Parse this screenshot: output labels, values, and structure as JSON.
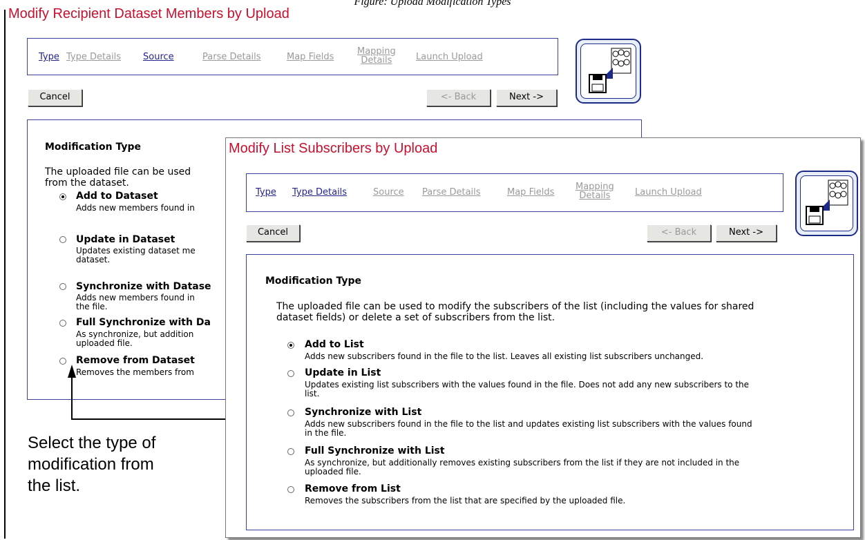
{
  "caption": "Figure: Upload Modification Types",
  "back_window": {
    "title": "Modify Recipient Dataset Members by Upload",
    "steps": [
      {
        "label": "Type",
        "state": "active"
      },
      {
        "label": "Type Details",
        "state": "inactive"
      },
      {
        "label": "Source",
        "state": "active"
      },
      {
        "label": "Parse Details",
        "state": "inactive"
      },
      {
        "label": "Map Fields",
        "state": "inactive"
      },
      {
        "label_line1": "Mapping",
        "label_line2": "Details",
        "state": "inactive"
      },
      {
        "label": "Launch Upload",
        "state": "inactive"
      }
    ],
    "cancel": "Cancel",
    "back": "<- Back",
    "next": "Next ->",
    "section_heading": "Modification Type",
    "intro_line1": "The uploaded file can be used",
    "intro_line2": "from the dataset.",
    "options": [
      {
        "label": "Add to Dataset",
        "desc1": "Adds new members found in",
        "desc2": "",
        "selected": true
      },
      {
        "label": "Update in Dataset",
        "desc1": "Updates existing dataset me",
        "desc2": "dataset.",
        "selected": false
      },
      {
        "label": "Synchronize with Datase",
        "desc1": "Adds new members found in",
        "desc2": "the file.",
        "selected": false
      },
      {
        "label": "Full Synchronize with Da",
        "desc1": "As synchronize, but addition",
        "desc2": "uploaded file.",
        "selected": false
      },
      {
        "label": "Remove from Dataset",
        "desc1": "Removes the members from",
        "desc2": "",
        "selected": false
      }
    ]
  },
  "front_window": {
    "title": "Modify List Subscribers by Upload",
    "steps": [
      {
        "label": "Type",
        "state": "active"
      },
      {
        "label": "Type Details",
        "state": "active"
      },
      {
        "label": "Source",
        "state": "inactive"
      },
      {
        "label": "Parse Details",
        "state": "inactive"
      },
      {
        "label": "Map Fields",
        "state": "inactive"
      },
      {
        "label_line1": "Mapping",
        "label_line2": "Details",
        "state": "inactive"
      },
      {
        "label": "Launch Upload",
        "state": "inactive"
      }
    ],
    "cancel": "Cancel",
    "back": "<- Back",
    "next": "Next ->",
    "section_heading": "Modification Type",
    "intro_line1": "The uploaded file can be used to modify the subscribers of the list (including the values for shared",
    "intro_line2": "dataset fields) or delete a set of subscribers from the list.",
    "options": [
      {
        "label": "Add to List",
        "desc1": "Adds new subscribers found in the file to the list. Leaves all existing list subscribers unchanged.",
        "desc2": "",
        "selected": true
      },
      {
        "label": "Update in List",
        "desc1": "Updates existing list subscribers with the values found in the file. Does not add any new subscribers to the",
        "desc2": "list.",
        "selected": false
      },
      {
        "label": "Synchronize with List",
        "desc1": "Adds new subscribers found in the file to the list and updates existing list subscribers with the values found",
        "desc2": "in the file.",
        "selected": false
      },
      {
        "label": "Full Synchronize with List",
        "desc1": "As synchronize, but additionally removes existing subscribers from the list if they are not included in the",
        "desc2": "uploaded file.",
        "selected": false
      },
      {
        "label": "Remove from List",
        "desc1": "Removes the subscribers from the list that are specified by the uploaded file.",
        "desc2": "",
        "selected": false
      }
    ]
  },
  "annotation": {
    "line1": "Select the type of",
    "line2": "modification from",
    "line3": "the list."
  }
}
